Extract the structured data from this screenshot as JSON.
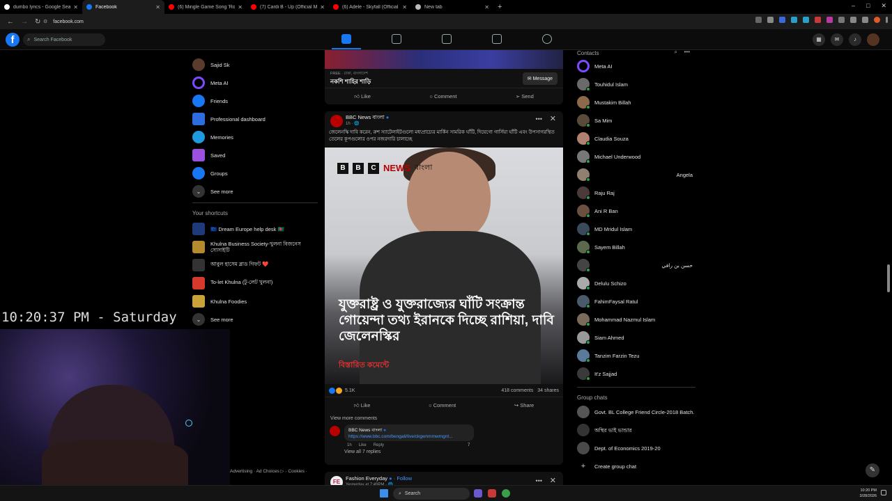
{
  "browser": {
    "tabs": [
      {
        "label": "dumbo lyrics - Google Search",
        "color": "#ffffff"
      },
      {
        "label": "Facebook",
        "color": "#1877f2"
      },
      {
        "label": "(6) Mingle Game Song 'Round",
        "color": "#ff0000"
      },
      {
        "label": "(7) Cardi B - Up (Official Music",
        "color": "#ff0000"
      },
      {
        "label": "(6) Adele - Skyfall (Official Lyric",
        "color": "#ff0000"
      },
      {
        "label": "New tab",
        "color": "#bbbbbb"
      }
    ],
    "close_glyph": "✕",
    "new_tab_glyph": "+",
    "url": "facebook.com"
  },
  "fb": {
    "logo": "f",
    "search_placeholder": "Search Facebook",
    "accent": "#1877f2"
  },
  "left_nav": {
    "items": [
      {
        "label": "Sajid Sk",
        "color": "#5a3b2c"
      },
      {
        "label": "Meta AI",
        "color": "#7b4bff"
      },
      {
        "label": "Friends",
        "color": "#1877f2"
      },
      {
        "label": "Professional dashboard",
        "color": "#2e6de0"
      },
      {
        "label": "Memories",
        "color": "#1f9ae0"
      },
      {
        "label": "Saved",
        "color": "#9b51e0"
      },
      {
        "label": "Groups",
        "color": "#1877f2"
      }
    ],
    "see_more": "See more",
    "shortcuts_title": "Your shortcuts",
    "shortcuts": [
      {
        "label": "🇪🇺 Dream Europe help desk 🇧🇩",
        "color": "#1e3a7a"
      },
      {
        "label": "Khulna Business Society-খুলনা বিজনেস সোসাইটি",
        "color": "#b38a2e"
      },
      {
        "label": "আবুল হাসেম ব্লাড গিফট ❤️",
        "color": "#333333"
      },
      {
        "label": "To-let Khulna (টু-লেট খুলনা)",
        "color": "#d63a2a"
      },
      {
        "label": "Khulna Foodies",
        "color": "#c9a23a"
      }
    ],
    "see_more_2": "See more"
  },
  "ad_post": {
    "meta": "FREE · ঢাকা, বাংলাদেশ",
    "name": "নকশি শাহির শাড়ি",
    "message_btn": "Message",
    "like": "Like",
    "comment": "Comment",
    "send": "Send"
  },
  "post": {
    "page": "BBC News বাংলা",
    "time": "1h · 🌐",
    "text": "জেলেনস্কি দাবি করেন, রুশ স্যাটেলাইটগুলো মধ্যপ্রাচ্যের মার্কিন সামরিক ঘাঁটি, দিয়েগো গার্সিয়া ঘাঁটি এবং উপসাগরস্থিত তেলের কূপগুলোর ওপর নজরদারি চালাচ্ছে",
    "brand_box": "B",
    "brand_news": "NEWS",
    "brand_lang": "বাংলা",
    "headline": "যুক্তরাষ্ট্র ও যুক্তরাজ্যের ঘাঁটি সংক্রান্ত গোয়েন্দা তথ্য ইরানকে দিচ্ছে রাশিয়া, দাবি জেলেনস্কির",
    "red_caption": "বিস্তারিত কমেন্টে",
    "reactions": "5.1K",
    "comments": "418 comments",
    "shares": "34 shares",
    "like": "Like",
    "comment": "Comment",
    "share": "Share",
    "view_more": "View more comments",
    "comment_author": "BBC News বাংলা",
    "comment_link": "https://www.bbc.com/bengali/live/ckgwnmmwmgnt...",
    "comment_time": "1h",
    "comment_like": "Like",
    "comment_reply": "Reply",
    "comment_reacts": "7",
    "replies": "View all 7 replies"
  },
  "post2": {
    "page": "Fashion Everyday",
    "follow": "· Follow",
    "time": "Yesterday at 7:49PM · 🌐",
    "avatar": "FE"
  },
  "contacts": {
    "title": "Contacts",
    "items": [
      {
        "name": "Meta AI",
        "color": "#7b4bff",
        "online": false
      },
      {
        "name": "Touhidul Islam",
        "color": "#6a6a6a",
        "online": true
      },
      {
        "name": "Mustakim Billah",
        "color": "#8a6a4a",
        "online": true
      },
      {
        "name": "Sa Mim",
        "color": "#5a4a3a",
        "online": true
      },
      {
        "name": "Claudia Souza",
        "color": "#b08070",
        "online": true
      },
      {
        "name": "Michael Underwood",
        "color": "#777777",
        "online": true
      },
      {
        "name": "Angela",
        "color": "#908070",
        "online": true
      },
      {
        "name": "Raju Raj",
        "color": "#4a3a3a",
        "online": true
      },
      {
        "name": "Ani R Ban",
        "color": "#6a5040",
        "online": true
      },
      {
        "name": "MD Mridul Islam",
        "color": "#3a4a5a",
        "online": true
      },
      {
        "name": "Sayem Billah",
        "color": "#5a6a4a",
        "online": true
      },
      {
        "name": "حسن بن رافي",
        "color": "#444444",
        "online": true
      },
      {
        "name": "Delulu Schizo",
        "color": "#aaaaaa",
        "online": true
      },
      {
        "name": "FahimFaysal Ratul",
        "color": "#4a5a6a",
        "online": true
      },
      {
        "name": "Mohammad Nazmul Islam",
        "color": "#7a6a5a",
        "online": true
      },
      {
        "name": "Siam Ahmed",
        "color": "#999999",
        "online": true
      },
      {
        "name": "Tanzim Farzin Tezu",
        "color": "#5a7a9a",
        "online": true
      },
      {
        "name": "It'z Sajjad",
        "color": "#3a3a3a",
        "online": true
      }
    ],
    "group_title": "Group chats",
    "groups": [
      {
        "name": "Govt. BL College Friend Circle-2018 Batch.",
        "color": "#555555"
      },
      {
        "name": "অস্থির ভাই ভান্ডার",
        "color": "#333333"
      },
      {
        "name": "Dept. of Economics 2019-20",
        "color": "#4a4a4a"
      }
    ],
    "create_group": "Create group chat"
  },
  "overlay": {
    "clock": "10:20:37 PM - Saturday"
  },
  "footer": "Advertising · Ad Choices ▷ · Cookies ·",
  "taskbar": {
    "search": "Search",
    "time": "10:20 PM",
    "date": "3/28/2026"
  }
}
